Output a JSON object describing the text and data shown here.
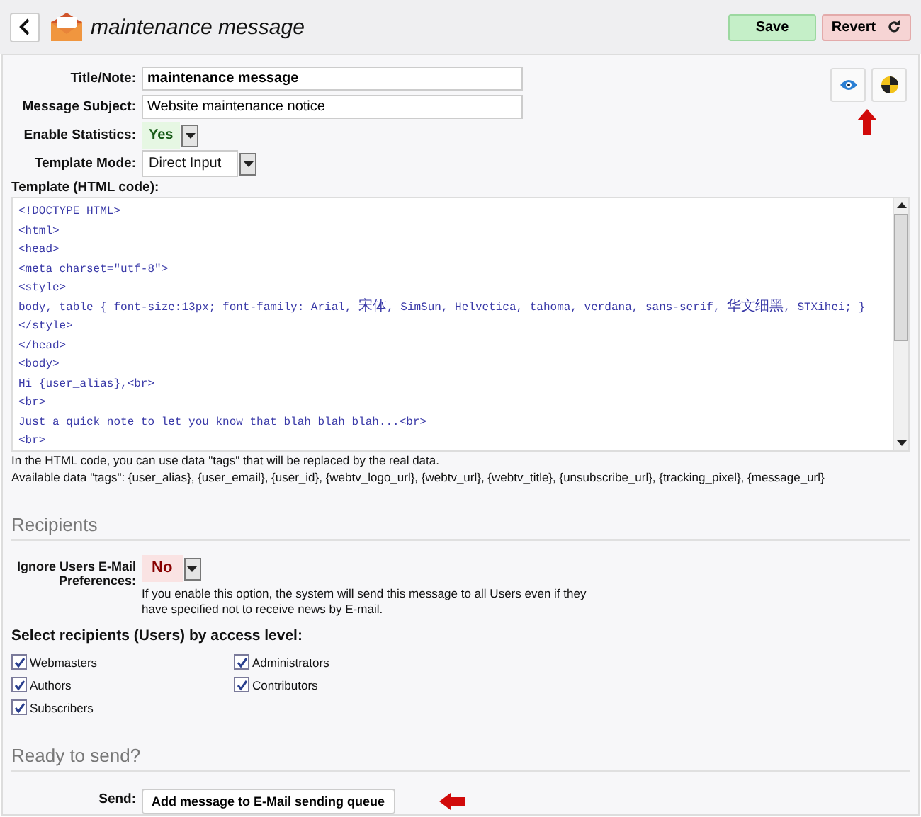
{
  "header": {
    "title": "maintenance message",
    "buttons": [
      {
        "kind": "save",
        "label": "Save"
      },
      {
        "kind": "revert",
        "label": "Revert"
      }
    ]
  },
  "fields": [
    {
      "kind": "text",
      "label": "Title/Note:",
      "value": "maintenance message",
      "bold": true
    },
    {
      "kind": "text",
      "label": "Message Subject:",
      "value": "Website maintenance notice",
      "bold": false
    },
    {
      "kind": "toggle",
      "label": "Enable Statistics:",
      "value": "Yes",
      "on": true
    },
    {
      "kind": "select",
      "label": "Template Mode:",
      "value": "Direct Input"
    }
  ],
  "template": {
    "label": "Template (HTML code):",
    "lines": [
      "<!DOCTYPE HTML>",
      "<html>",
      "<head>",
      "<meta charset=\"utf-8\">",
      "<style>",
      "body, table { font-size:13px; font-family: Arial, 宋体, SimSun, Helvetica, tahoma, verdana, sans-serif, 华文细黑, STXihei; }",
      "</style>",
      "</head>",
      "<body>",
      "Hi {user_alias},<br>",
      "<br>",
      "Just a quick note to let you know that blah blah blah...<br>",
      "<br>"
    ],
    "help": [
      "In the HTML code, you can use data \"tags\" that will be replaced by the real data.",
      "Available data \"tags\": {user_alias}, {user_email}, {user_id}, {webtv_logo_url}, {webtv_url}, {webtv_title}, {unsubscribe_url}, {tracking_pixel}, {message_url}"
    ]
  },
  "recipients": {
    "heading": "Recipients",
    "ignore": {
      "label": "Ignore Users E-Mail Preferences:",
      "value": "No",
      "on": false,
      "help": "If you enable this option, the system will send this message to all Users even if they have specified not to receive news by E-mail."
    },
    "levels_heading": "Select recipients (Users) by access level:",
    "levels": [
      {
        "label": "Webmasters",
        "checked": true
      },
      {
        "label": "Administrators",
        "checked": true
      },
      {
        "label": "Authors",
        "checked": true
      },
      {
        "label": "Contributors",
        "checked": true
      },
      {
        "label": "Subscribers",
        "checked": true
      }
    ]
  },
  "send": {
    "heading": "Ready to send?",
    "label": "Send:",
    "button": "Add message to E-Mail sending queue"
  }
}
